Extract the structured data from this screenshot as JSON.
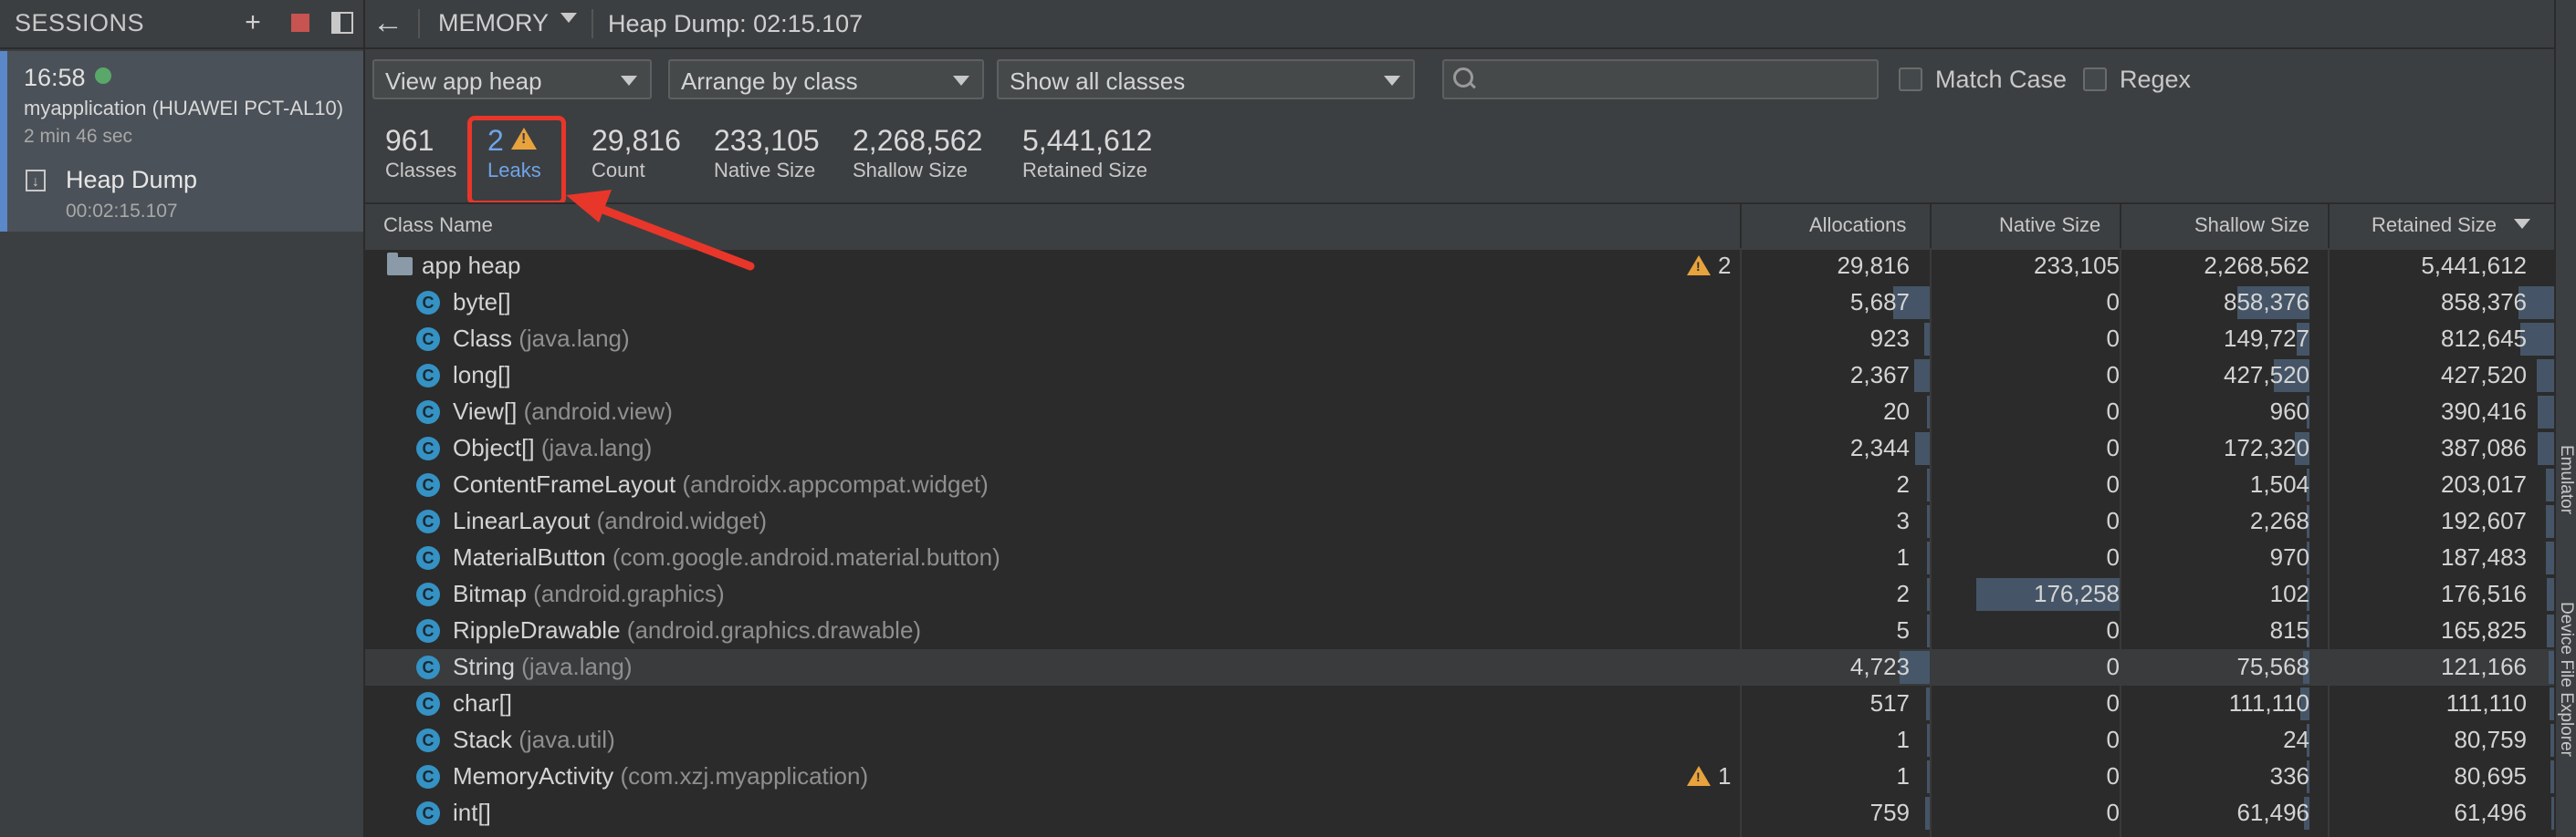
{
  "sessions": {
    "title": "SESSIONS",
    "session": {
      "time": "16:58",
      "device": "myapplication (HUAWEI PCT-AL10)",
      "duration": "2 min 46 sec"
    },
    "artifact": {
      "label": "Heap Dump",
      "time": "00:02:15.107"
    }
  },
  "toolbar": {
    "profiler": "MEMORY",
    "title": "Heap Dump: 02:15.107"
  },
  "filters": {
    "heap": "View app heap",
    "arrange": "Arrange by class",
    "classes": "Show all classes",
    "search_value": "",
    "match_case": "Match Case",
    "regex": "Regex"
  },
  "summary": {
    "classes": {
      "value": "961",
      "label": "Classes"
    },
    "leaks": {
      "value": "2",
      "label": "Leaks"
    },
    "count": {
      "value": "29,816",
      "label": "Count"
    },
    "native": {
      "value": "233,105",
      "label": "Native Size"
    },
    "shallow": {
      "value": "2,268,562",
      "label": "Shallow Size"
    },
    "retained": {
      "value": "5,441,612",
      "label": "Retained Size"
    }
  },
  "table": {
    "columns": [
      "Class Name",
      "Allocations",
      "Native Size",
      "Shallow Size",
      "Retained Size"
    ],
    "root": {
      "name": "app heap",
      "leaks": "2",
      "allocations": "29,816",
      "native": "233,105",
      "shallow": "2,268,562",
      "retained": "5,441,612"
    },
    "rows": [
      {
        "name": "byte[]",
        "pkg": "",
        "allocations": "5,687",
        "native": "0",
        "shallow": "858,376",
        "retained": "858,376",
        "leaks": ""
      },
      {
        "name": "Class",
        "pkg": "(java.lang)",
        "allocations": "923",
        "native": "0",
        "shallow": "149,727",
        "retained": "812,645",
        "leaks": ""
      },
      {
        "name": "long[]",
        "pkg": "",
        "allocations": "2,367",
        "native": "0",
        "shallow": "427,520",
        "retained": "427,520",
        "leaks": ""
      },
      {
        "name": "View[]",
        "pkg": "(android.view)",
        "allocations": "20",
        "native": "0",
        "shallow": "960",
        "retained": "390,416",
        "leaks": ""
      },
      {
        "name": "Object[]",
        "pkg": "(java.lang)",
        "allocations": "2,344",
        "native": "0",
        "shallow": "172,320",
        "retained": "387,086",
        "leaks": ""
      },
      {
        "name": "ContentFrameLayout",
        "pkg": "(androidx.appcompat.widget)",
        "allocations": "2",
        "native": "0",
        "shallow": "1,504",
        "retained": "203,017",
        "leaks": ""
      },
      {
        "name": "LinearLayout",
        "pkg": "(android.widget)",
        "allocations": "3",
        "native": "0",
        "shallow": "2,268",
        "retained": "192,607",
        "leaks": ""
      },
      {
        "name": "MaterialButton",
        "pkg": "(com.google.android.material.button)",
        "allocations": "1",
        "native": "0",
        "shallow": "970",
        "retained": "187,483",
        "leaks": ""
      },
      {
        "name": "Bitmap",
        "pkg": "(android.graphics)",
        "allocations": "2",
        "native": "176,258",
        "shallow": "102",
        "retained": "176,516",
        "leaks": ""
      },
      {
        "name": "RippleDrawable",
        "pkg": "(android.graphics.drawable)",
        "allocations": "5",
        "native": "0",
        "shallow": "815",
        "retained": "165,825",
        "leaks": ""
      },
      {
        "name": "String",
        "pkg": "(java.lang)",
        "allocations": "4,723",
        "native": "0",
        "shallow": "75,568",
        "retained": "121,166",
        "leaks": ""
      },
      {
        "name": "char[]",
        "pkg": "",
        "allocations": "517",
        "native": "0",
        "shallow": "111,110",
        "retained": "111,110",
        "leaks": ""
      },
      {
        "name": "Stack",
        "pkg": "(java.util)",
        "allocations": "1",
        "native": "0",
        "shallow": "24",
        "retained": "80,759",
        "leaks": ""
      },
      {
        "name": "MemoryActivity",
        "pkg": "(com.xzj.myapplication)",
        "allocations": "1",
        "native": "0",
        "shallow": "336",
        "retained": "80,695",
        "leaks": "1"
      },
      {
        "name": "int[]",
        "pkg": "",
        "allocations": "759",
        "native": "0",
        "shallow": "61,496",
        "retained": "61,496",
        "leaks": ""
      }
    ]
  },
  "right_tools": {
    "emulator": "Emulator",
    "device_file_explorer": "Device File Explorer"
  },
  "colors": {
    "background": "#3c3f41",
    "table_bg": "#2b2b2b",
    "accent": "#5a88c8",
    "warning": "#e8a33d",
    "annotation": "#e8362a",
    "class_icon": "#3592c4"
  }
}
